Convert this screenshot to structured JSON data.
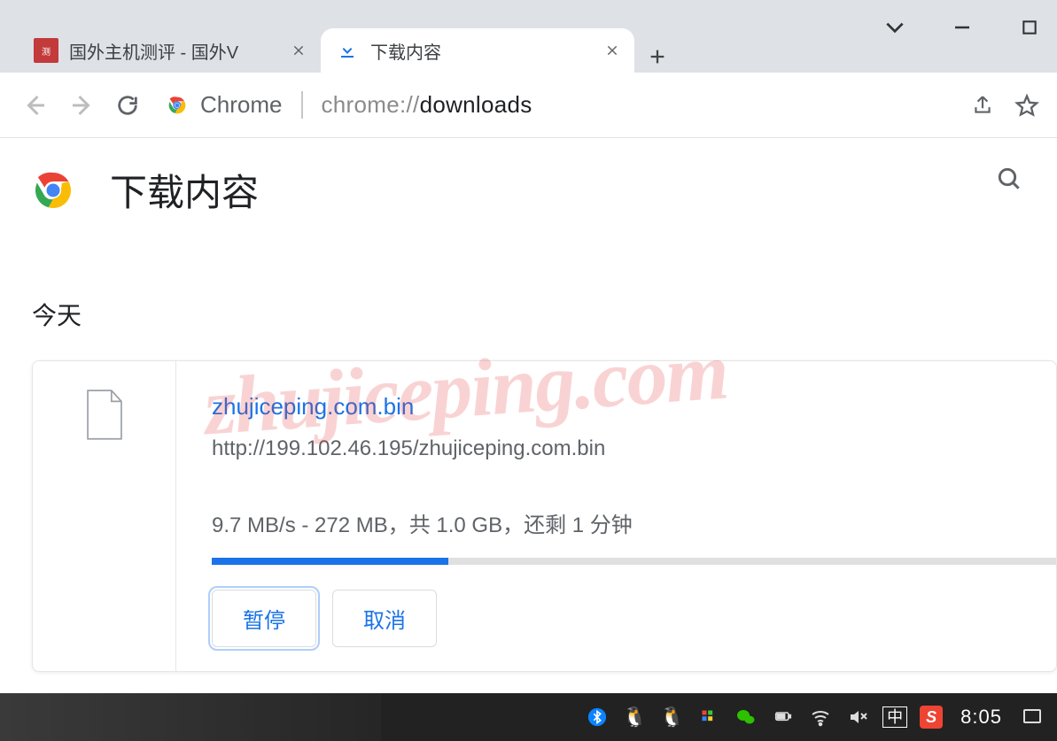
{
  "tabs": {
    "inactive": {
      "title": "国外主机测评 - 国外V"
    },
    "active": {
      "title": "下载内容"
    }
  },
  "omnibox": {
    "chip_label": "Chrome",
    "url_prefix": "chrome://",
    "url_strong": "downloads"
  },
  "page": {
    "title": "下载内容",
    "date_label": "今天"
  },
  "download": {
    "filename": "zhujiceping.com.bin",
    "url": "http://199.102.46.195/zhujiceping.com.bin",
    "status": "9.7 MB/s - 272 MB，共 1.0 GB，还剩 1 分钟",
    "pause_label": "暂停",
    "cancel_label": "取消",
    "progress_pct": 28
  },
  "watermark": "zhujiceping.com",
  "taskbar": {
    "ime": "中",
    "sogou": "S",
    "clock": "8:05"
  }
}
